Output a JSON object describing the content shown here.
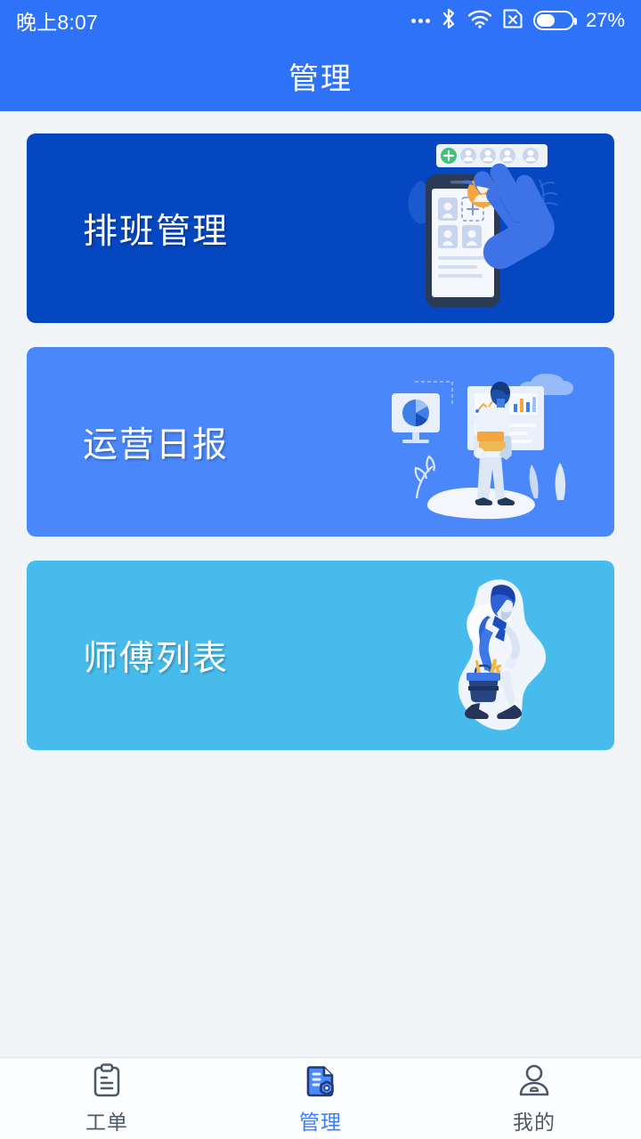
{
  "statusbar": {
    "time": "晚上8:07",
    "battery_percent": "27%",
    "battery_level": 27,
    "icons": [
      "more-dots-icon",
      "bluetooth-icon",
      "wifi-icon",
      "sim-no-signal-icon",
      "battery-icon"
    ]
  },
  "header": {
    "title": "管理"
  },
  "cards": [
    {
      "label": "排班管理",
      "color": "#0447C0",
      "art": "shift-management-illustration"
    },
    {
      "label": "运营日报",
      "color": "#4A87FB",
      "art": "daily-report-illustration"
    },
    {
      "label": "师傅列表",
      "color": "#47BCEC",
      "art": "technician-list-illustration"
    }
  ],
  "tabbar": {
    "items": [
      {
        "label": "工单",
        "icon": "clipboard-icon",
        "active": false
      },
      {
        "label": "管理",
        "icon": "document-gear-icon",
        "active": true
      },
      {
        "label": "我的",
        "icon": "person-icon",
        "active": false
      }
    ],
    "active_color": "#3D7EFF",
    "inactive_color": "#4C5A68"
  },
  "theme": {
    "page_background": "#F2F5F8",
    "header_background": "#2E73F7"
  }
}
